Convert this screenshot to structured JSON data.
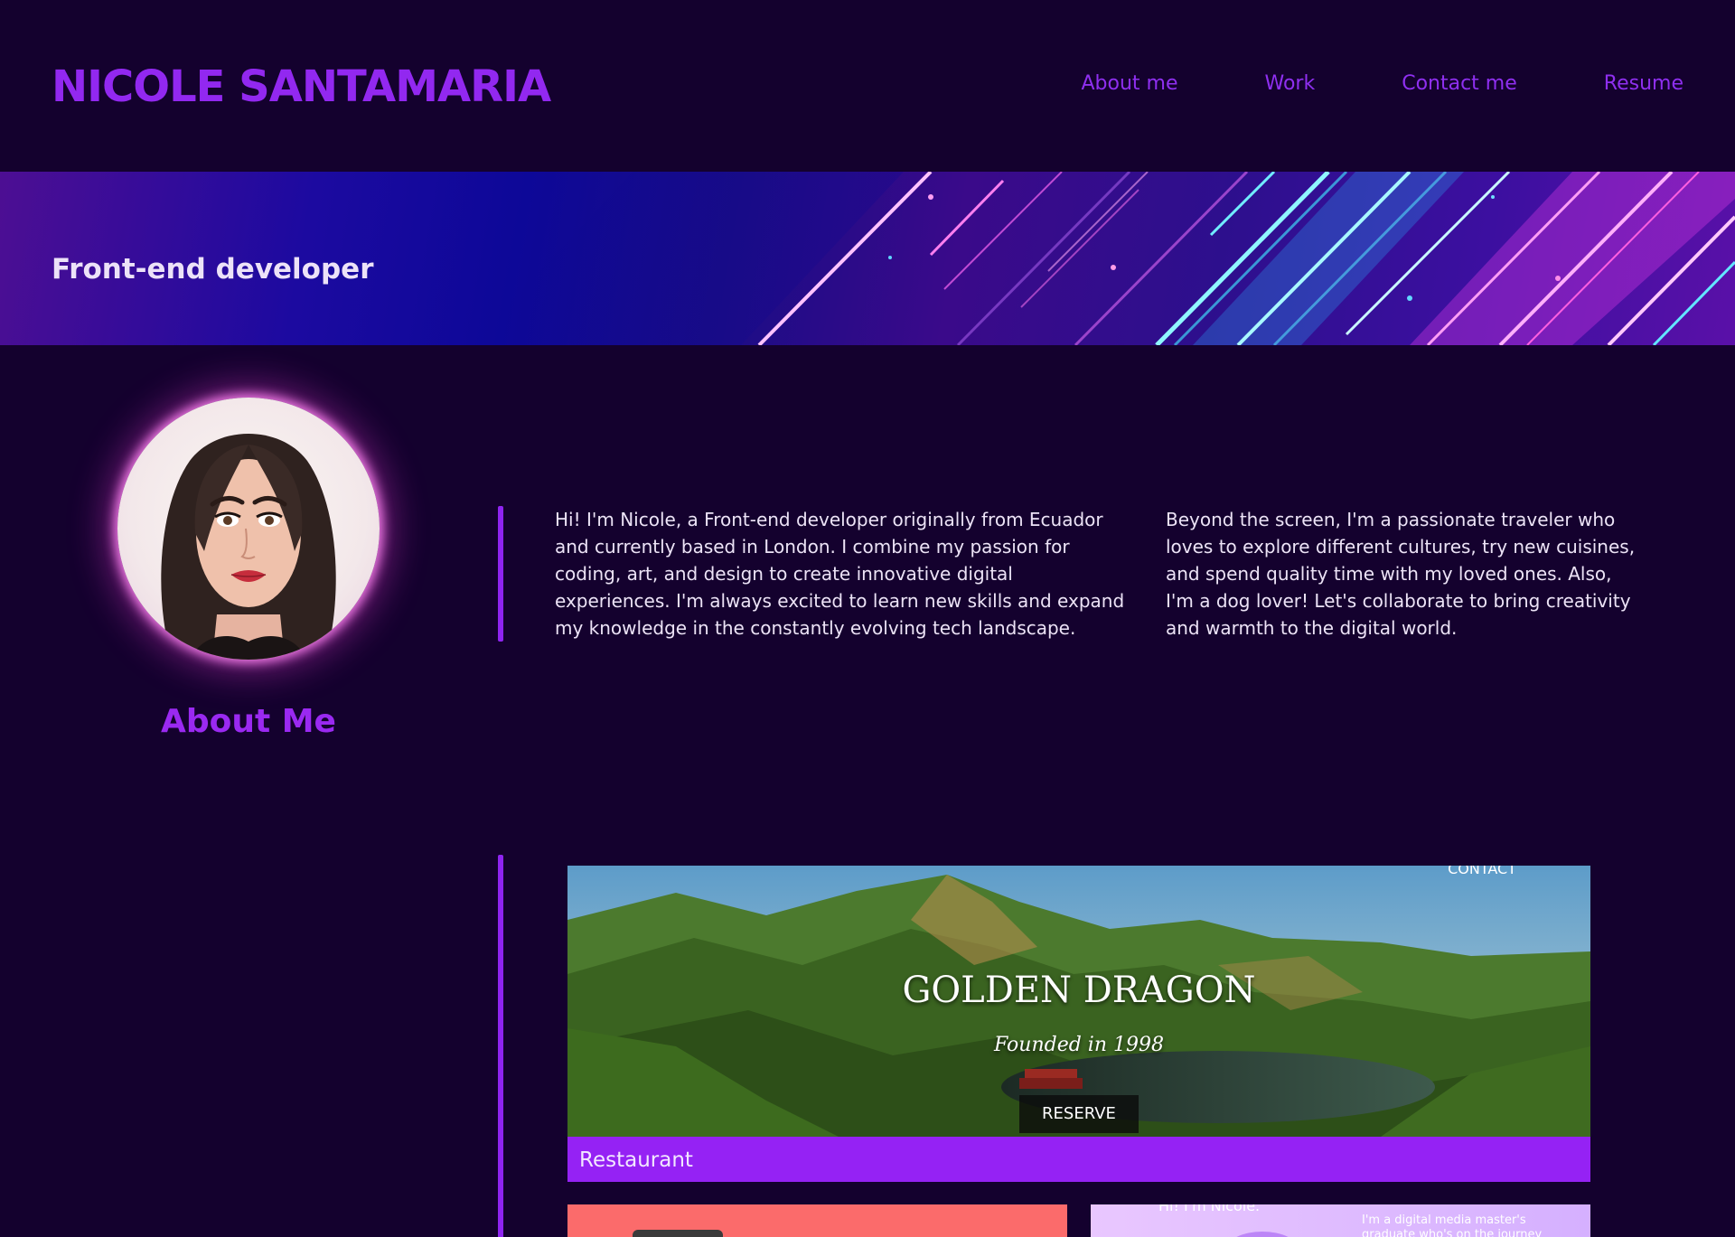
{
  "header": {
    "site_name": "NICOLE SANTAMARIA",
    "nav": [
      {
        "label": "About me"
      },
      {
        "label": "Work"
      },
      {
        "label": "Contact me"
      },
      {
        "label": "Resume"
      }
    ]
  },
  "banner": {
    "tagline": "Front-end developer"
  },
  "about": {
    "title": "About Me",
    "paragraph_left": "Hi! I'm Nicole, a Front-end developer originally from Ecuador and currently based in London. I combine my passion for coding, art, and design to create innovative digital experiences. I'm always excited to learn new skills and expand my knowledge in the constantly evolving tech landscape.",
    "paragraph_right": "Beyond the screen, I'm a passionate traveler who loves to explore different cultures, try new cuisines, and spend quality time with my loved ones. Also, I'm a dog lover! Let's collaborate to bring creativity and warmth to the digital world."
  },
  "work": {
    "projects": [
      {
        "label": "Restaurant",
        "screenshot": {
          "nav_text": "CONTACT",
          "title": "GOLDEN DRAGON",
          "subtitle": "Founded in 1998",
          "button": "RESERVE"
        }
      },
      {
        "label": "",
        "screenshot": {}
      },
      {
        "label": "",
        "screenshot": {
          "heading": "Hi! I'm Nicole.",
          "text": "I'm a digital media master's graduate who's on the journey"
        }
      }
    ]
  },
  "colors": {
    "background": "#14012e",
    "accent": "#9228f0",
    "label_bar": "#9522f4",
    "body_text": "#ece3f6"
  }
}
